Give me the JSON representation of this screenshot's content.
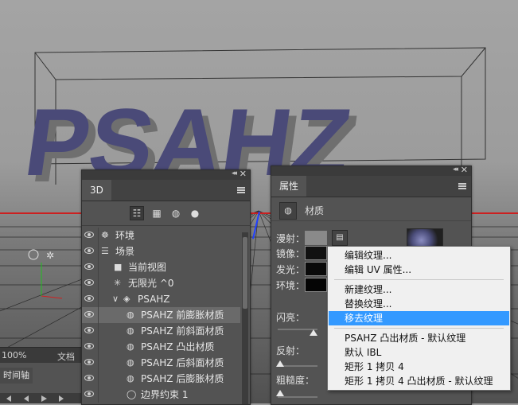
{
  "canvas": {
    "text_3d": "PSAHZ",
    "text_color": "#4a4a78",
    "status": {
      "zoom": "100%",
      "doc": "文档"
    },
    "timeline_tab": "时间轴"
  },
  "panel_3d": {
    "tab": "3D",
    "toolbar": [
      "scene-filter-icon",
      "mesh-filter-icon",
      "material-filter-icon",
      "light-filter-icon"
    ],
    "rows": [
      {
        "label": "环境",
        "icon": "environment-icon",
        "indent": 0,
        "selected": false
      },
      {
        "label": "场景",
        "icon": "scene-icon",
        "indent": 0,
        "selected": false
      },
      {
        "label": "当前视图",
        "icon": "camera-icon",
        "indent": 1,
        "selected": false
      },
      {
        "label": "无限光 ^0",
        "icon": "sun-icon",
        "indent": 1,
        "selected": false
      },
      {
        "label": "PSAHZ",
        "icon": "mesh-icon",
        "indent": 1,
        "selected": false,
        "expanded": true
      },
      {
        "label": "PSAHZ 前膨胀材质",
        "icon": "material-icon",
        "indent": 2,
        "selected": true
      },
      {
        "label": "PSAHZ 前斜面材质",
        "icon": "material-icon",
        "indent": 2,
        "selected": false
      },
      {
        "label": "PSAHZ 凸出材质",
        "icon": "material-icon",
        "indent": 2,
        "selected": false
      },
      {
        "label": "PSAHZ 后斜面材质",
        "icon": "material-icon",
        "indent": 2,
        "selected": false
      },
      {
        "label": "PSAHZ 后膨胀材质",
        "icon": "material-icon",
        "indent": 2,
        "selected": false
      },
      {
        "label": "边界约束 1",
        "icon": "constraint-icon",
        "indent": 2,
        "selected": false
      }
    ]
  },
  "panel_props": {
    "tab": "属性",
    "header": "材质",
    "labels": {
      "diffuse": "漫射：",
      "specular": "镜像：",
      "glow": "发光：",
      "ambient": "环境：",
      "shine": "闪亮：",
      "reflection": "反射：",
      "roughness": "粗糙度："
    },
    "colors": {
      "diffuse": "#8a8a8a",
      "specular": "#111111",
      "glow": "#0a0a0a",
      "ambient": "#050505"
    }
  },
  "context_menu": {
    "items": [
      {
        "label": "编辑纹理...",
        "highlighted": false
      },
      {
        "label": "编辑 UV 属性...",
        "highlighted": false
      },
      {
        "divider": true
      },
      {
        "label": "新建纹理...",
        "highlighted": false
      },
      {
        "label": "替换纹理...",
        "highlighted": false
      },
      {
        "label": "移去纹理",
        "highlighted": true
      },
      {
        "divider": true
      },
      {
        "label": "PSAHZ 凸出材质 - 默认纹理",
        "highlighted": false
      },
      {
        "label": "默认 IBL",
        "highlighted": false
      },
      {
        "label": "矩形 1 拷贝 4",
        "highlighted": false
      },
      {
        "label": "矩形 1 拷贝 4 凸出材质 - 默认纹理",
        "highlighted": false
      }
    ]
  }
}
